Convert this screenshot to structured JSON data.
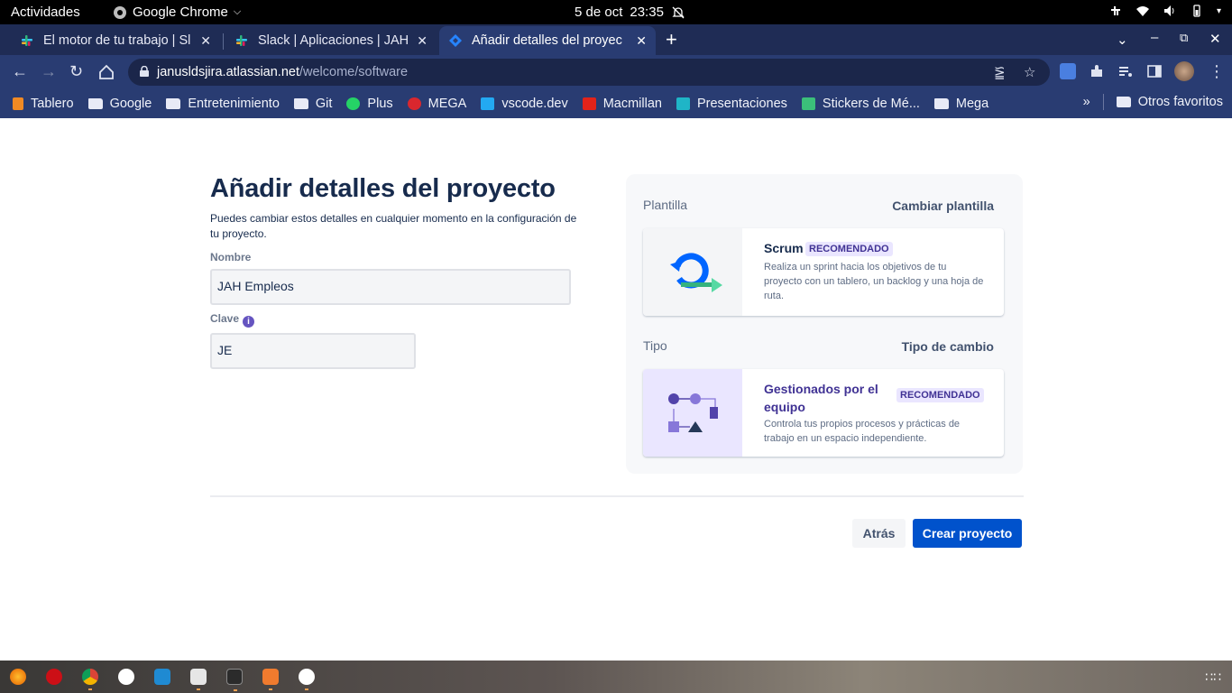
{
  "system_bar": {
    "activities": "Actividades",
    "app_name": "Google Chrome",
    "date": "5 de oct",
    "time": "23:35"
  },
  "tabs": [
    {
      "title": "El motor de tu trabajo | Sl",
      "active": false
    },
    {
      "title": "Slack | Aplicaciones | JAH E",
      "active": false
    },
    {
      "title": "Añadir detalles del proyec",
      "active": true
    }
  ],
  "address_bar": {
    "domain": "janusldsjira.atlassian.net",
    "path": "/welcome/software"
  },
  "bookmarks": {
    "items": [
      {
        "label": "Tablero",
        "icon": "tablero-icon"
      },
      {
        "label": "Google",
        "icon": "folder-icon"
      },
      {
        "label": "Entretenimiento",
        "icon": "folder-icon"
      },
      {
        "label": "Git",
        "icon": "folder-icon"
      },
      {
        "label": "Plus",
        "icon": "plus-icon"
      },
      {
        "label": "MEGA",
        "icon": "mega-icon"
      },
      {
        "label": "vscode.dev",
        "icon": "vscode-icon"
      },
      {
        "label": "Macmillan",
        "icon": "macmillan-icon"
      },
      {
        "label": "Presentaciones",
        "icon": "presentaciones-icon"
      },
      {
        "label": "Stickers de Mé...",
        "icon": "stickers-icon"
      },
      {
        "label": "Mega",
        "icon": "folder-icon"
      }
    ],
    "overflow": "»",
    "other": "Otros favoritos"
  },
  "page": {
    "title": "Añadir detalles del proyecto",
    "description": "Puedes cambiar estos detalles en cualquier momento en la configuración de tu proyecto.",
    "name_label": "Nombre",
    "name_value": "JAH Empleos",
    "key_label": "Clave",
    "key_value": "JE",
    "template": {
      "heading": "Plantilla",
      "change_link": "Cambiar plantilla",
      "card_title": "Scrum",
      "badge": "RECOMENDADO",
      "card_text": "Realiza un sprint hacia los objetivos de tu proyecto con un tablero, un backlog y una hoja de ruta."
    },
    "type": {
      "heading": "Tipo",
      "change_link": "Tipo de cambio",
      "card_title": "Gestionados por el equipo",
      "badge": "RECOMENDADO",
      "card_text": "Controla tus propios procesos y prácticas de trabajo en un espacio independiente."
    },
    "back_button": "Atrás",
    "create_button": "Crear proyecto"
  },
  "colors": {
    "primary": "#0052cc",
    "badge_bg": "#eae6ff",
    "badge_text": "#403294",
    "heading_text": "#172b4d"
  }
}
